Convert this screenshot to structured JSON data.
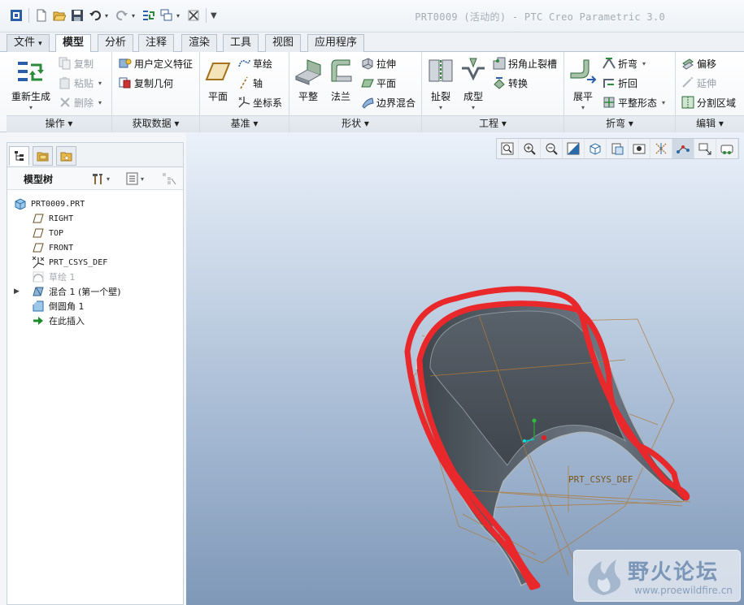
{
  "window": {
    "title": "PRT0009 (活动的) - PTC Creo Parametric 3.0"
  },
  "quick_access": [
    "窗口图标",
    "新建",
    "打开",
    "保存",
    "撤消",
    "重做",
    "重新生成",
    "窗口",
    "关闭",
    "自定义"
  ],
  "tabs": [
    {
      "label": "文件",
      "dropdown": "▾"
    },
    {
      "label": "模型"
    },
    {
      "label": "分析"
    },
    {
      "label": "注释"
    },
    {
      "label": "渲染"
    },
    {
      "label": "工具"
    },
    {
      "label": "视图"
    },
    {
      "label": "应用程序"
    }
  ],
  "ribbon": {
    "operations": {
      "title": "操作",
      "regenerate": "重新生成",
      "copy": "复制",
      "paste": "粘贴",
      "delete": "删除"
    },
    "get_data": {
      "title": "获取数据",
      "udf": "用户定义特征",
      "copy_geom": "复制几何"
    },
    "datum": {
      "title": "基准",
      "plane": "平面",
      "sketch": "草绘",
      "axis": "轴",
      "csys": "坐标系"
    },
    "shapes": {
      "title": "形状",
      "flat": "平整",
      "flange": "法兰",
      "extrude": "拉伸",
      "planar": "平面",
      "boundary_blend": "边界混合"
    },
    "engineering": {
      "title": "工程",
      "rip": "扯裂",
      "form": "成型",
      "corner_relief": "拐角止裂槽",
      "convert": "转换"
    },
    "bends": {
      "title": "折弯",
      "unbend": "展平",
      "bend": "折弯",
      "bend_back": "折回",
      "flatten_form": "平整形态"
    },
    "editing": {
      "title": "编辑",
      "offset": "偏移",
      "extend": "延伸",
      "split_area": "分割区域"
    }
  },
  "model_tree": {
    "title": "模型树",
    "items": [
      {
        "label": "PRT0009.PRT",
        "icon": "part-icon"
      },
      {
        "label": "RIGHT",
        "icon": "datum-plane-icon"
      },
      {
        "label": "TOP",
        "icon": "datum-plane-icon"
      },
      {
        "label": "FRONT",
        "icon": "datum-plane-icon"
      },
      {
        "label": "PRT_CSYS_DEF",
        "icon": "csys-icon"
      },
      {
        "label": "草绘 1",
        "icon": "sketch-icon",
        "dimmed": true
      },
      {
        "label": "混合 1 (第一个壁)",
        "icon": "blend-icon",
        "expandable": true
      },
      {
        "label": "倒圆角 1",
        "icon": "round-icon"
      },
      {
        "label": "在此插入",
        "icon": "insert-here-icon"
      }
    ]
  },
  "viewport": {
    "csys_label": "PRT_CSYS_DEF"
  },
  "watermark": {
    "text": "野火论坛",
    "url": "www.proewildfire.cn"
  },
  "colors": {
    "highlight": "#e8282b",
    "model": "#6d7782",
    "datum": "#b17a35"
  }
}
